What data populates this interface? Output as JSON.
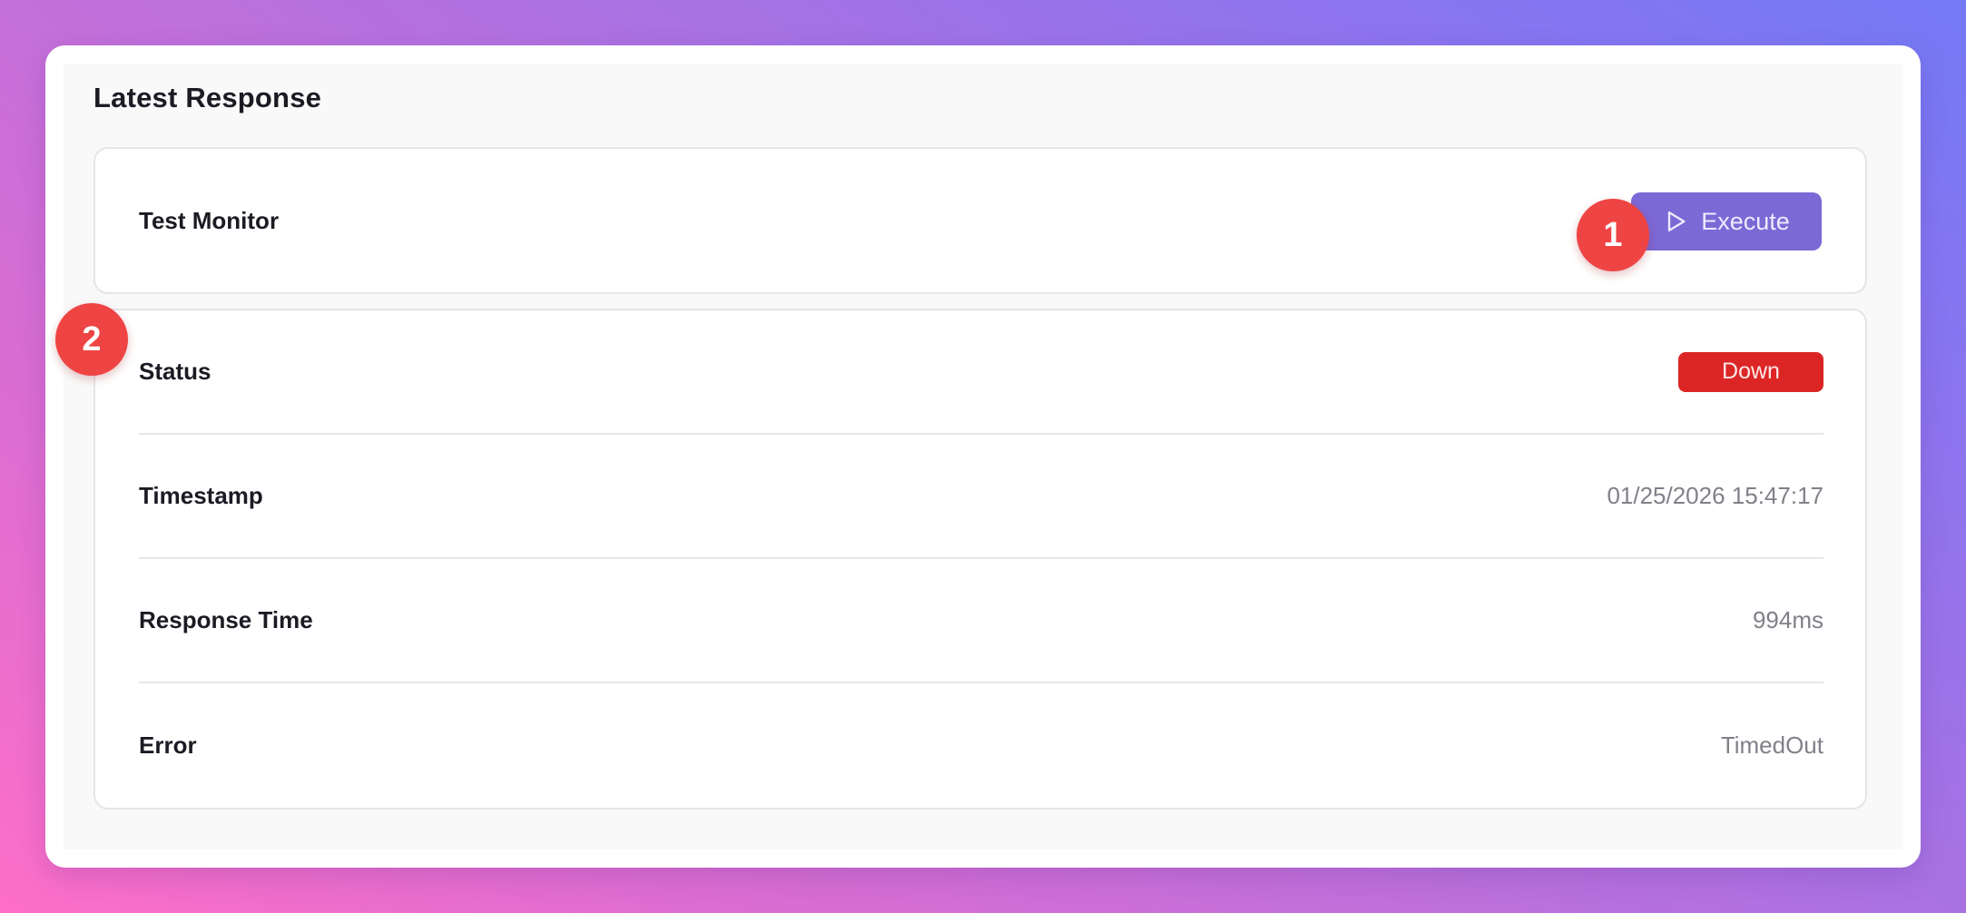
{
  "panel": {
    "title": "Latest Response"
  },
  "monitor": {
    "name": "Test Monitor",
    "execute_label": "Execute",
    "execute_icon": "play-icon",
    "button_color": "#7b69d6"
  },
  "details": {
    "rows": [
      {
        "label": "Status",
        "value": "Down"
      },
      {
        "label": "Timestamp",
        "value": "01/25/2026 15:47:17"
      },
      {
        "label": "Response Time",
        "value": "994ms"
      },
      {
        "label": "Error",
        "value": "TimedOut"
      }
    ],
    "status_color": "#dc2626"
  },
  "markers": [
    "1",
    "2"
  ]
}
